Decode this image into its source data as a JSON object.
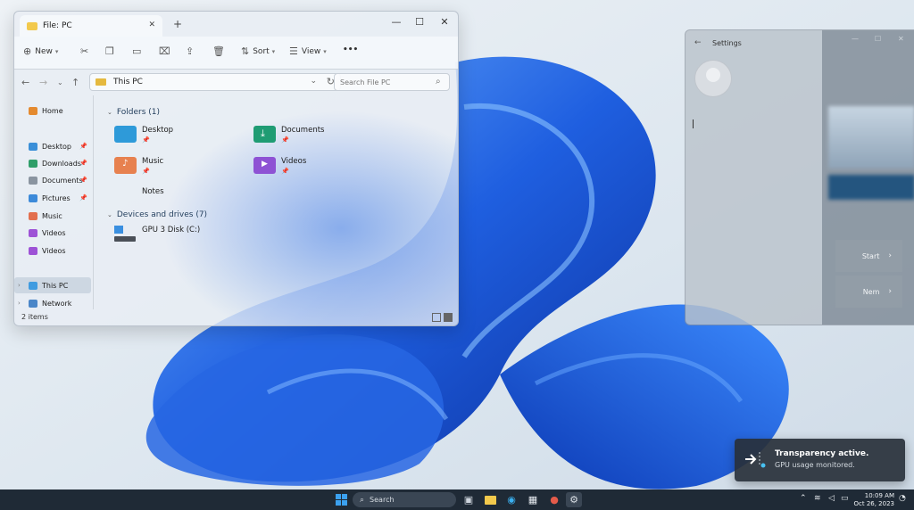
{
  "explorer": {
    "tab_title": "File: PC",
    "toolbar": {
      "new_label": "New",
      "sort_label": "Sort",
      "view_label": "View",
      "more_label": "•••"
    },
    "address": "This PC",
    "search_placeholder": "Search File PC",
    "nav": {
      "home": "Home",
      "pinned": [
        {
          "label": "Desktop",
          "color": "#3a8fd8"
        },
        {
          "label": "Downloads",
          "color": "#2f9e69"
        },
        {
          "label": "Documents",
          "color": "#8a94a0"
        },
        {
          "label": "Pictures",
          "color": "#3c8ad9"
        },
        {
          "label": "Music",
          "color": "#e26f4e"
        },
        {
          "label": "Videos",
          "color": "#9d52d6"
        },
        {
          "label": "Videos",
          "color": "#9d52d6"
        }
      ],
      "this_pc": "This PC",
      "network": "Network"
    },
    "folders_header": "Folders (1)",
    "folders": [
      {
        "label": "Desktop",
        "color": "#2e9ad9"
      },
      {
        "label": "Documents",
        "color": "#1f9c73"
      },
      {
        "label": "Music",
        "color": "#e7814f"
      },
      {
        "label": "Videos",
        "color": "#8e52d4"
      }
    ],
    "notes_label": "Notes",
    "drives_header": "Devices and drives (7)",
    "drive_label": "GPU 3 Disk (C:)",
    "status": "2 items"
  },
  "settings": {
    "title": "Settings",
    "card1": "Start",
    "card2": "Nem"
  },
  "toast": {
    "title": "Transparency active.",
    "body": "GPU usage monitored."
  },
  "taskbar": {
    "search_label": "Search",
    "time": "10:09 AM",
    "date": "Oct 26, 2023"
  },
  "colors": {
    "accent": "#1f63d8",
    "taskbar": "#1f2a36"
  }
}
